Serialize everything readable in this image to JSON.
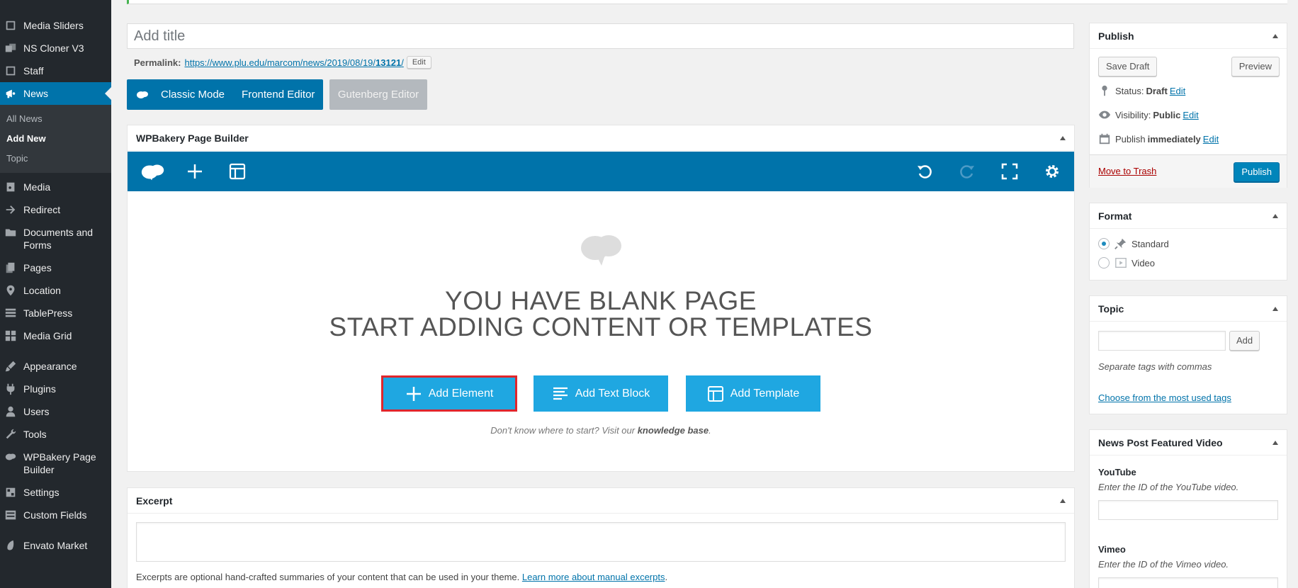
{
  "sidebar": {
    "items": [
      {
        "label": "Media Sliders",
        "icon": "slides-icon"
      },
      {
        "label": "NS Cloner V3",
        "icon": "cloner-icon"
      },
      {
        "label": "Staff",
        "icon": "staff-icon"
      },
      {
        "label": "News",
        "icon": "megaphone-icon"
      },
      {
        "label": "Media",
        "icon": "media-icon"
      },
      {
        "label": "Redirect",
        "icon": "arrow-right-icon"
      },
      {
        "label": "Documents and Forms",
        "icon": "folder-icon"
      },
      {
        "label": "Pages",
        "icon": "pages-icon"
      },
      {
        "label": "Location",
        "icon": "location-icon"
      },
      {
        "label": "TablePress",
        "icon": "table-icon"
      },
      {
        "label": "Media Grid",
        "icon": "grid-icon"
      },
      {
        "label": "Appearance",
        "icon": "brush-icon"
      },
      {
        "label": "Plugins",
        "icon": "plugin-icon"
      },
      {
        "label": "Users",
        "icon": "users-icon"
      },
      {
        "label": "Tools",
        "icon": "wrench-icon"
      },
      {
        "label": "WPBakery Page Builder",
        "icon": "wpbakery-icon"
      },
      {
        "label": "Settings",
        "icon": "settings-icon"
      },
      {
        "label": "Custom Fields",
        "icon": "custom-fields-icon"
      },
      {
        "label": "Envato Market",
        "icon": "envato-icon"
      }
    ],
    "submenu": [
      "All News",
      "Add New",
      "Topic"
    ]
  },
  "editor": {
    "title_placeholder": "Add title",
    "permalink_label": "Permalink:",
    "permalink_url_prefix": "https://www.plu.edu/marcom/news/2019/08/19/",
    "permalink_slug": "13121",
    "permalink_url_suffix": "/",
    "permalink_edit": "Edit",
    "modes": {
      "classic": "Classic Mode",
      "frontend": "Frontend Editor",
      "gutenberg": "Gutenberg Editor"
    }
  },
  "wpbakery": {
    "title": "WPBakery Page Builder",
    "blank_line1": "YOU HAVE BLANK PAGE",
    "blank_line2": "START ADDING CONTENT OR TEMPLATES",
    "add_element": "Add Element",
    "add_text_block": "Add Text Block",
    "add_template": "Add Template",
    "help_prefix": "Don't know where to start? Visit our ",
    "help_link": "knowledge base",
    "help_suffix": ".",
    "accent": "#0073aa",
    "button_color": "#1fa7e1",
    "highlight_color": "#e0262c"
  },
  "excerpt": {
    "title": "Excerpt",
    "help_text": "Excerpts are optional hand-crafted summaries of your content that can be used in your theme. ",
    "help_link": "Learn more about manual excerpts",
    "help_suffix": "."
  },
  "publish": {
    "title": "Publish",
    "save_draft": "Save Draft",
    "preview": "Preview",
    "status_label": "Status:",
    "status_value": "Draft",
    "visibility_label": "Visibility:",
    "visibility_value": "Public",
    "publish_label": "Publish",
    "publish_value": "immediately",
    "edit": "Edit",
    "trash": "Move to Trash",
    "publish_button": "Publish"
  },
  "format": {
    "title": "Format",
    "options": [
      {
        "label": "Standard",
        "checked": true
      },
      {
        "label": "Video",
        "checked": false
      }
    ]
  },
  "topic": {
    "title": "Topic",
    "add": "Add",
    "help": "Separate tags with commas",
    "choose_link": "Choose from the most used tags"
  },
  "featured_video": {
    "title": "News Post Featured Video",
    "youtube_label": "YouTube",
    "youtube_help": "Enter the ID of the YouTube video.",
    "vimeo_label": "Vimeo",
    "vimeo_help": "Enter the ID of the Vimeo video."
  }
}
